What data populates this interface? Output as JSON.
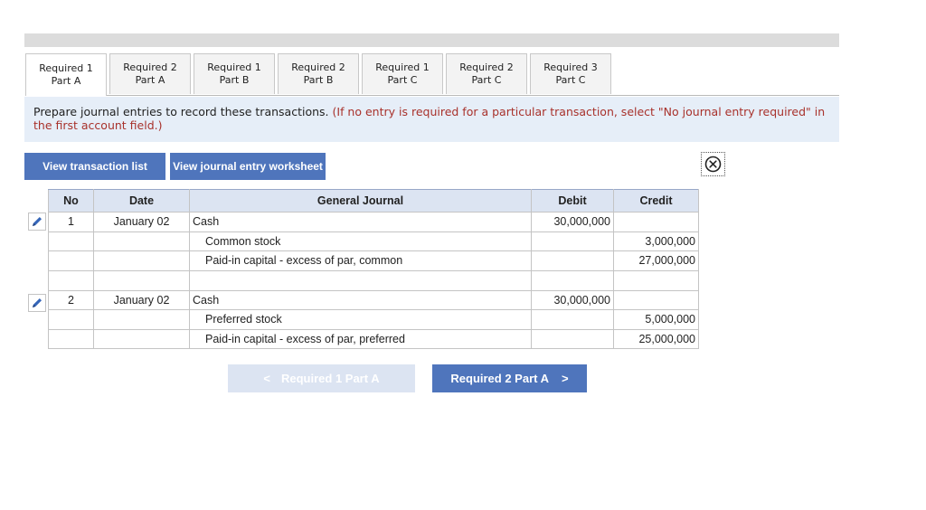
{
  "tabs": [
    {
      "line1": "Required 1",
      "line2": "Part A"
    },
    {
      "line1": "Required 2",
      "line2": "Part A"
    },
    {
      "line1": "Required 1",
      "line2": "Part B"
    },
    {
      "line1": "Required 2",
      "line2": "Part B"
    },
    {
      "line1": "Required 1",
      "line2": "Part C"
    },
    {
      "line1": "Required 2",
      "line2": "Part C"
    },
    {
      "line1": "Required 3",
      "line2": "Part C"
    }
  ],
  "instructions": {
    "main": "Prepare journal entries to record these transactions.",
    "note": "(If no entry is required for a particular transaction, select \"No journal entry required\" in the first account field.)"
  },
  "buttons": {
    "view_transactions": "View transaction list",
    "view_worksheet": "View journal entry worksheet"
  },
  "journal": {
    "headers": {
      "no": "No",
      "date": "Date",
      "account": "General Journal",
      "debit": "Debit",
      "credit": "Credit"
    },
    "entries": [
      {
        "no": "1",
        "date": "January 02",
        "lines": [
          {
            "account": "Cash",
            "debit": "30,000,000",
            "credit": ""
          },
          {
            "account": "Common stock",
            "debit": "",
            "credit": "3,000,000"
          },
          {
            "account": "Paid-in capital - excess of par, common",
            "debit": "",
            "credit": "27,000,000"
          }
        ]
      },
      {
        "no": "2",
        "date": "January 02",
        "lines": [
          {
            "account": "Cash",
            "debit": "30,000,000",
            "credit": ""
          },
          {
            "account": "Preferred stock",
            "debit": "",
            "credit": "5,000,000"
          },
          {
            "account": "Paid-in capital - excess of par, preferred",
            "debit": "",
            "credit": "25,000,000"
          }
        ]
      }
    ]
  },
  "nav": {
    "prev_label": "Required 1 Part A",
    "next_label": "Required 2 Part A",
    "prev_glyph": "<",
    "next_glyph": ">"
  },
  "icons": {
    "edit": "pencil-icon",
    "close": "close-circle-icon"
  },
  "colors": {
    "accent": "#4f75bc",
    "header_bg": "#dce4f2",
    "instruction_bg": "#e6eef8",
    "note_red": "#a8312b"
  }
}
